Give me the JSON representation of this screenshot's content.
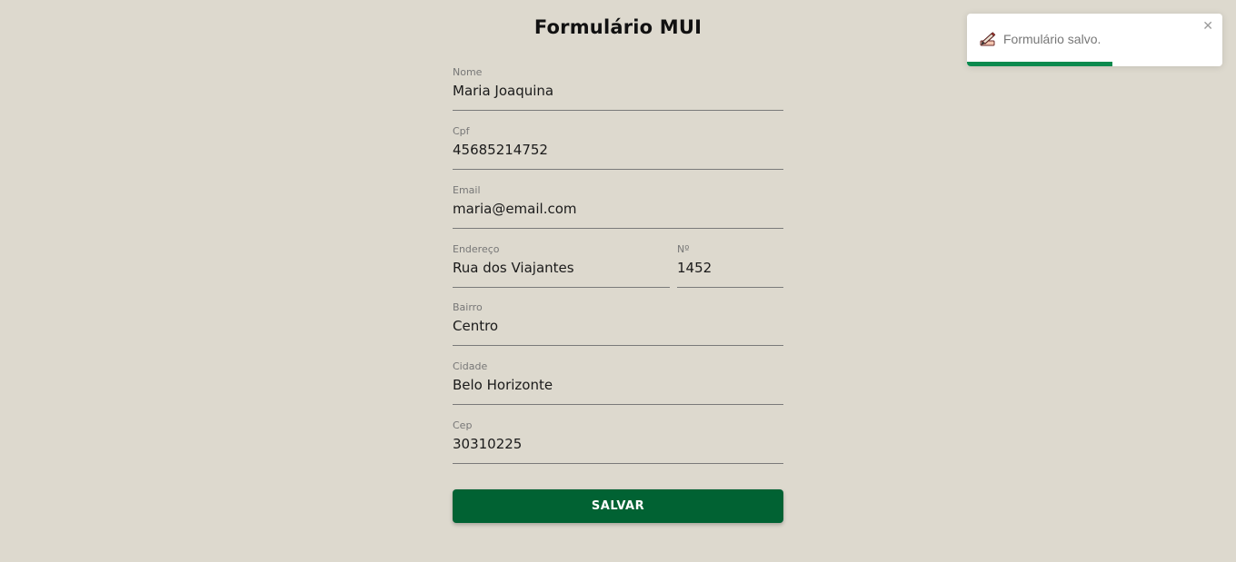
{
  "title": "Formulário MUI",
  "form": {
    "nome": {
      "label": "Nome",
      "value": "Maria Joaquina"
    },
    "cpf": {
      "label": "Cpf",
      "value": "45685214752"
    },
    "email": {
      "label": "Email",
      "value": "maria@email.com"
    },
    "endereco": {
      "label": "Endereço",
      "value": "Rua dos Viajantes"
    },
    "numero": {
      "label": "Nº",
      "value": "1452"
    },
    "bairro": {
      "label": "Bairro",
      "value": "Centro"
    },
    "cidade": {
      "label": "Cidade",
      "value": "Belo Horizonte"
    },
    "cep": {
      "label": "Cep",
      "value": "30310225"
    },
    "save_label": "SALVAR"
  },
  "toast": {
    "icon": "pencil-writing-icon",
    "message": "Formulário salvo.",
    "close_icon": "close-icon",
    "progress": 0.57,
    "progress_color": "#0a8a4e"
  },
  "colors": {
    "background": "#ddd9ce",
    "button": "#016233"
  }
}
